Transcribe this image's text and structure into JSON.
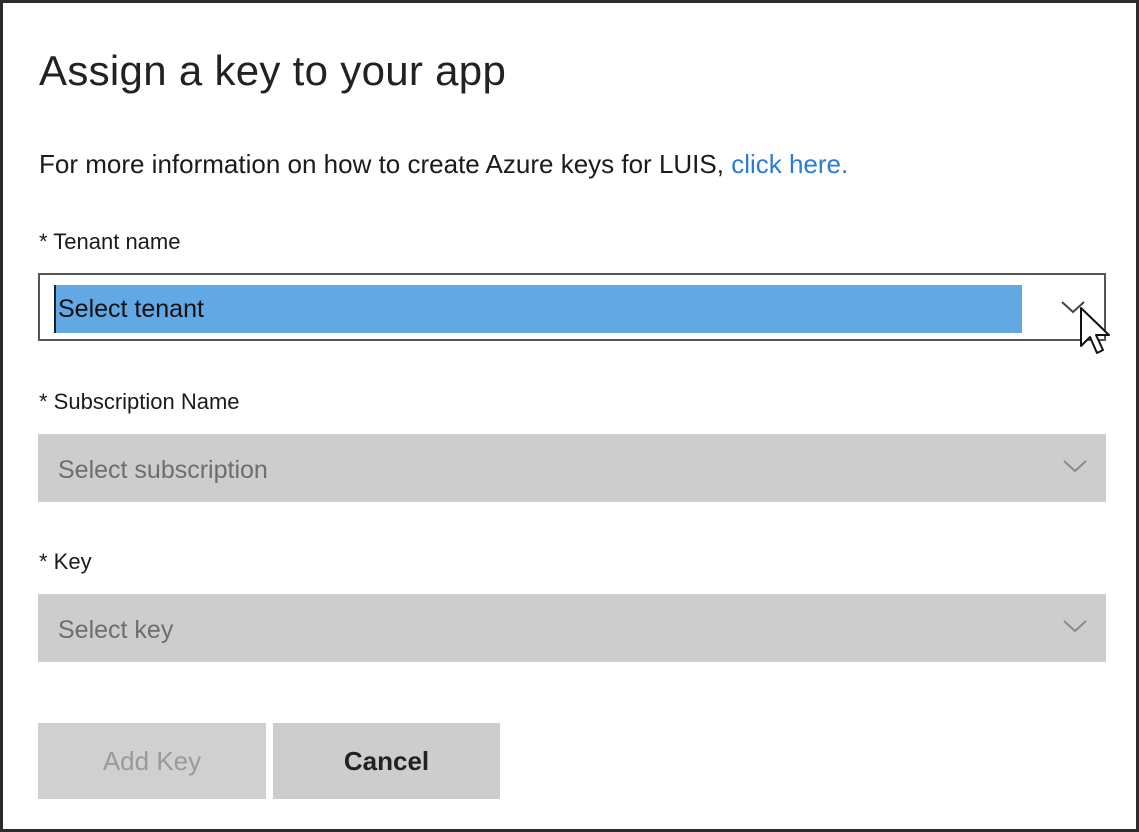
{
  "dialog": {
    "title": "Assign a key to your app",
    "info_text": "For more information on how to create Azure keys for LUIS, ",
    "info_link": "click here."
  },
  "fields": {
    "tenant": {
      "label": "* Tenant name",
      "value": "Select tenant"
    },
    "subscription": {
      "label": "* Subscription Name",
      "value": "Select subscription"
    },
    "key": {
      "label": "* Key",
      "value": "Select key"
    }
  },
  "buttons": {
    "add_key": "Add Key",
    "cancel": "Cancel"
  },
  "colors": {
    "link": "#2b7cd3",
    "selection_highlight": "#62a8e5",
    "disabled_field": "#cdcdcd"
  },
  "icons": {
    "dropdown": "chevron-down-icon",
    "pointer": "mouse-cursor-icon"
  }
}
